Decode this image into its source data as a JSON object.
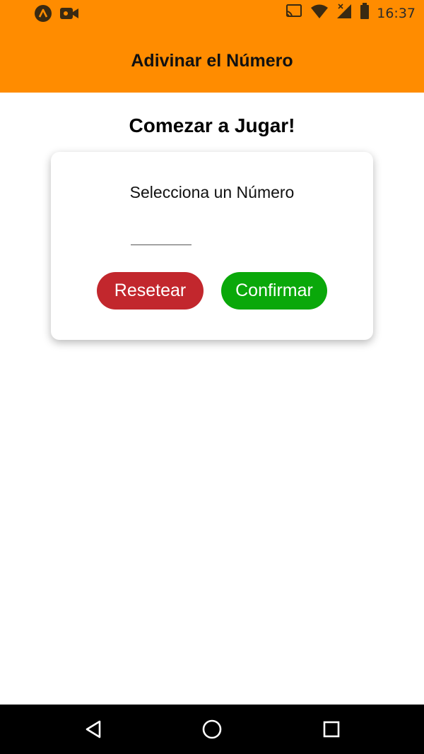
{
  "status_bar": {
    "time": "16:37",
    "left_icons": [
      "app-notification-icon",
      "video-camera-icon"
    ],
    "right_icons": [
      "cast-icon",
      "wifi-icon",
      "signal-icon",
      "battery-icon"
    ]
  },
  "header": {
    "title": "Adivinar el Número"
  },
  "main": {
    "title": "Comezar a Jugar!",
    "card": {
      "label": "Selecciona un Número",
      "input_value": "",
      "reset_label": "Resetear",
      "confirm_label": "Confirmar"
    }
  },
  "nav_bar": {
    "buttons": [
      "back-icon",
      "home-icon",
      "recents-icon"
    ]
  },
  "colors": {
    "header": "#ff8c00",
    "reset": "#c2272d",
    "confirm": "#0aa80a"
  }
}
